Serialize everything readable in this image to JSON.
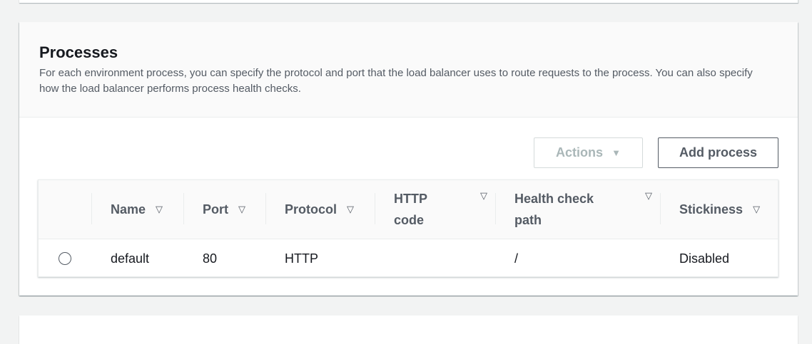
{
  "panel": {
    "title": "Processes",
    "description": "For each environment process, you can specify the protocol and port that the load balancer uses to route requests to the process. You can also specify how the load balancer performs process health checks."
  },
  "toolbar": {
    "actions_label": "Actions",
    "add_label": "Add process"
  },
  "table": {
    "columns": [
      "Name",
      "Port",
      "Protocol",
      "HTTP code",
      "Health check path",
      "Stickiness"
    ],
    "rows": [
      {
        "selected": false,
        "name": "default",
        "port": "80",
        "protocol": "HTTP",
        "http_code": "",
        "health_path": "/",
        "stickiness": "Disabled"
      }
    ]
  },
  "icons": {
    "sort": "sort-triangle-down-icon",
    "dropdown": "caret-down-icon",
    "radio": "radio-unchecked-icon"
  },
  "colors": {
    "accent_text": "#545b64",
    "disabled_text": "#aab7b8",
    "border": "#eaeded",
    "background": "#f2f3f3"
  }
}
